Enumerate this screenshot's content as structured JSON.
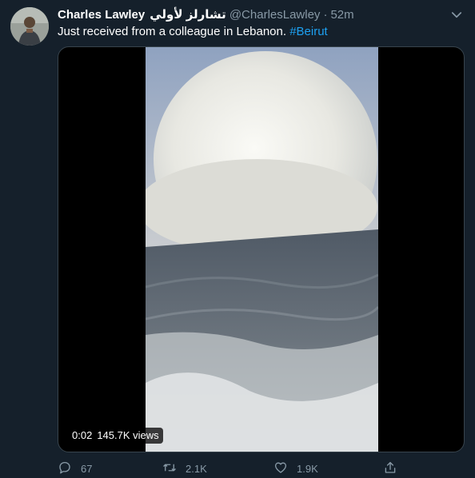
{
  "tweet": {
    "display_name": "Charles Lawley",
    "display_name_arabic": "تشارلز لأولي",
    "handle": "@CharlesLawley",
    "separator": "·",
    "time": "52m",
    "text": "Just received from a colleague in Lebanon. ",
    "hashtag": "#Beirut"
  },
  "video": {
    "elapsed": "0:02",
    "views": "145.7K views"
  },
  "actions": {
    "replies": "67",
    "retweets": "2.1K",
    "likes": "1.9K"
  },
  "icons": [
    "caret-down-icon",
    "reply-icon",
    "retweet-icon",
    "like-icon",
    "share-icon"
  ],
  "colors": {
    "background": "#15202b",
    "secondary_text": "#8899a6",
    "link": "#1da1f2",
    "border": "#38444d"
  }
}
